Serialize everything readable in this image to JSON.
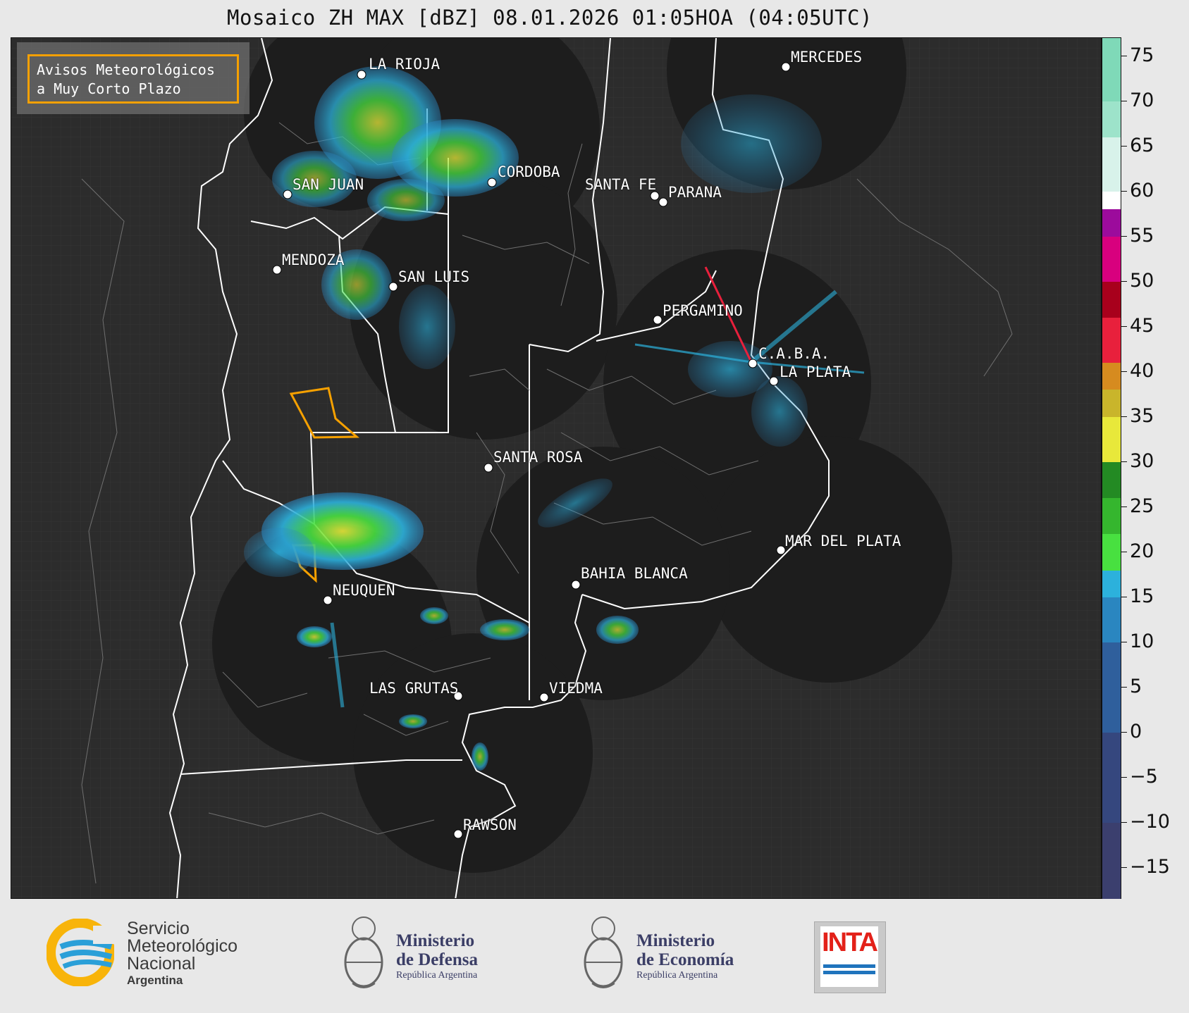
{
  "title": "Mosaico ZH MAX [dBZ] 08.01.2026 01:05HOA (04:05UTC)",
  "legend": {
    "line1": "Avisos Meteorológicos",
    "line2": "a Muy Corto Plazo",
    "border_color": "#f5a000"
  },
  "cities": [
    {
      "name": "LA RIOJA"
    },
    {
      "name": "MERCEDES"
    },
    {
      "name": "CORDOBA"
    },
    {
      "name": "SAN JUAN"
    },
    {
      "name": "SANTA FE"
    },
    {
      "name": "PARANA"
    },
    {
      "name": "MENDOZA"
    },
    {
      "name": "SAN LUIS"
    },
    {
      "name": "PERGAMINO"
    },
    {
      "name": "C.A.B.A."
    },
    {
      "name": "LA PLATA"
    },
    {
      "name": "SANTA ROSA"
    },
    {
      "name": "NEUQUEN"
    },
    {
      "name": "MAR DEL PLATA"
    },
    {
      "name": "BAHIA BLANCA"
    },
    {
      "name": "LAS GRUTAS"
    },
    {
      "name": "VIEDMA"
    },
    {
      "name": "RAWSON"
    }
  ],
  "colorbar": {
    "unit": "dBZ",
    "ticks": [
      "75",
      "70",
      "65",
      "60",
      "55",
      "50",
      "45",
      "40",
      "35",
      "30",
      "25",
      "20",
      "15",
      "10",
      "5",
      "0",
      "−5",
      "−10",
      "−15"
    ],
    "range": [
      -18.5,
      77
    ],
    "stops": [
      {
        "from": -18.5,
        "color": "#3b3f6e"
      },
      {
        "from": -10,
        "color": "#35477e"
      },
      {
        "from": 0,
        "color": "#2f5f9c"
      },
      {
        "from": 10,
        "color": "#2a86c0"
      },
      {
        "from": 15,
        "color": "#2cb1dc"
      },
      {
        "from": 18,
        "color": "#48e040"
      },
      {
        "from": 22,
        "color": "#35b62e"
      },
      {
        "from": 26,
        "color": "#238a23"
      },
      {
        "from": 30,
        "color": "#e8e83a"
      },
      {
        "from": 35,
        "color": "#c9b52b"
      },
      {
        "from": 38,
        "color": "#d68b1f"
      },
      {
        "from": 41,
        "color": "#e8203c"
      },
      {
        "from": 46,
        "color": "#a8001c"
      },
      {
        "from": 50,
        "color": "#d8007e"
      },
      {
        "from": 55,
        "color": "#9c0b9c"
      },
      {
        "from": 58,
        "color": "#ffffff"
      },
      {
        "from": 60,
        "color": "#d8f2ea"
      },
      {
        "from": 66,
        "color": "#9de3ca"
      },
      {
        "from": 70,
        "color": "#7fd9b8"
      }
    ]
  },
  "footer": {
    "smn_line1": "Servicio",
    "smn_line2": "Meteorológico",
    "smn_line3": "Nacional",
    "smn_line4": "Argentina",
    "defensa_line1": "Ministerio",
    "defensa_line2": "de Defensa",
    "defensa_line3": "República Argentina",
    "economia_line1": "Ministerio",
    "economia_line2": "de Economía",
    "economia_line3": "República Argentina",
    "inta": "INTA"
  }
}
